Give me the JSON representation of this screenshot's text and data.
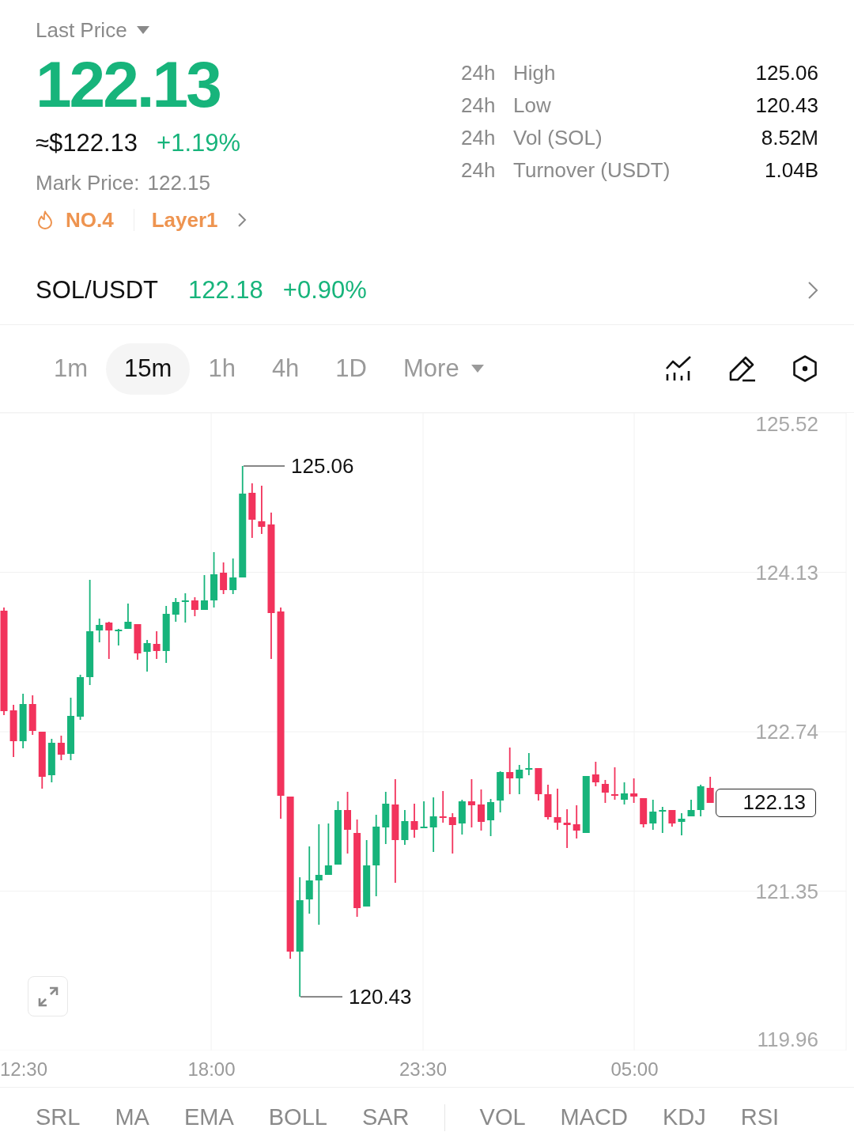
{
  "price_header": {
    "price_type": "Last Price",
    "last_price": "122.13",
    "usd_value": "≈$122.13",
    "change": "+1.19%",
    "mark_price_label": "Mark Price:",
    "mark_price": "122.15",
    "rank": "NO.4",
    "sector": "Layer1"
  },
  "stats": [
    {
      "period": "24h",
      "label": "High",
      "value": "125.06"
    },
    {
      "period": "24h",
      "label": "Low",
      "value": "120.43"
    },
    {
      "period": "24h",
      "label": "Vol (SOL)",
      "value": "8.52M"
    },
    {
      "period": "24h",
      "label": "Turnover (USDT)",
      "value": "1.04B"
    }
  ],
  "pair": {
    "symbol": "SOL/USDT",
    "price": "122.18",
    "change": "+0.90%"
  },
  "timeframes": [
    {
      "label": "1m",
      "selected": false,
      "kind": "interval"
    },
    {
      "label": "15m",
      "selected": true,
      "kind": "interval"
    },
    {
      "label": "1h",
      "selected": false,
      "kind": "interval"
    },
    {
      "label": "4h",
      "selected": false,
      "kind": "interval"
    },
    {
      "label": "1D",
      "selected": false,
      "kind": "interval"
    },
    {
      "label": "More",
      "selected": false,
      "kind": "menu"
    }
  ],
  "chart": {
    "price_axis": [
      "125.52",
      "124.13",
      "122.74",
      "121.35",
      "119.96"
    ],
    "high_marker": "125.06",
    "low_marker": "120.43",
    "current_price": "122.13",
    "time_axis": [
      "12:30",
      "18:00",
      "23:30",
      "05:00"
    ]
  },
  "indicators": {
    "main": [
      "SRL",
      "MA",
      "EMA",
      "BOLL",
      "SAR"
    ],
    "sub": [
      "VOL",
      "MACD",
      "KDJ",
      "RSI"
    ]
  }
}
